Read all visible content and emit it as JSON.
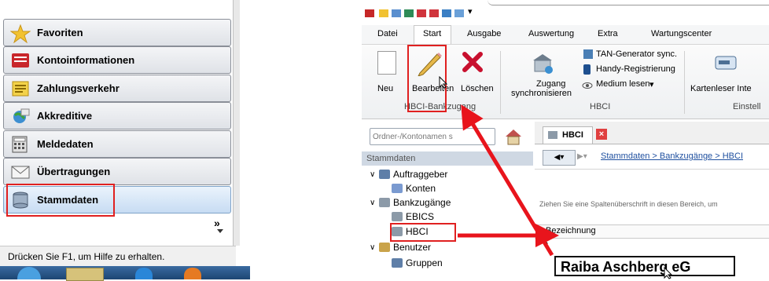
{
  "left_panel": {
    "nav_items": [
      {
        "label": "Favoriten",
        "icon": "star-icon"
      },
      {
        "label": "Kontoinformationen",
        "icon": "account-book-icon"
      },
      {
        "label": "Zahlungsverkehr",
        "icon": "payment-icon"
      },
      {
        "label": "Akkreditive",
        "icon": "globe-icon"
      },
      {
        "label": "Meldedaten",
        "icon": "calculator-icon"
      },
      {
        "label": "Übertragungen",
        "icon": "envelope-icon"
      },
      {
        "label": "Stammdaten",
        "icon": "database-icon"
      }
    ],
    "expand_glyph": "»",
    "status_text": "Drücken Sie F1, um Hilfe zu erhalten."
  },
  "right_panel": {
    "menu_tabs": [
      "Datei",
      "Start",
      "Ausgabe",
      "Auswertung",
      "Extra",
      "Wartungscenter"
    ],
    "ribbon": {
      "neu": "Neu",
      "bearbeiten": "Bearbeiten",
      "loeschen": "Löschen",
      "group_bankzugang": "HBCI-Bankzugang",
      "zugang_line1": "Zugang",
      "zugang_line2": "synchronisieren",
      "tan_generator": "TAN-Generator sync.",
      "handy": "Handy-Registrierung",
      "medium": "Medium lesen",
      "group_hbci": "HBCI",
      "kartenleser": "Kartenleser Inte",
      "group_einstell": "Einstell"
    },
    "search_placeholder": "Ordner-/Kontonamen s",
    "doc_tab": "HBCI",
    "breadcrumb": "Stammdaten > Bankzugänge > HBCI",
    "group_hint": "Ziehen Sie eine Spaltenüberschrift in diesen Bereich, um",
    "column_header": "Bezeichnung",
    "tree": {
      "header": "Stammdaten",
      "items": [
        "Auftraggeber",
        "Konten",
        "Bankzugänge",
        "EBICS",
        "HBCI",
        "Benutzer",
        "Gruppen"
      ]
    },
    "callout": "Raiba Aschberg eG"
  },
  "colors": {
    "highlight_red": "#e02020",
    "arrow_red": "#e8141c"
  }
}
